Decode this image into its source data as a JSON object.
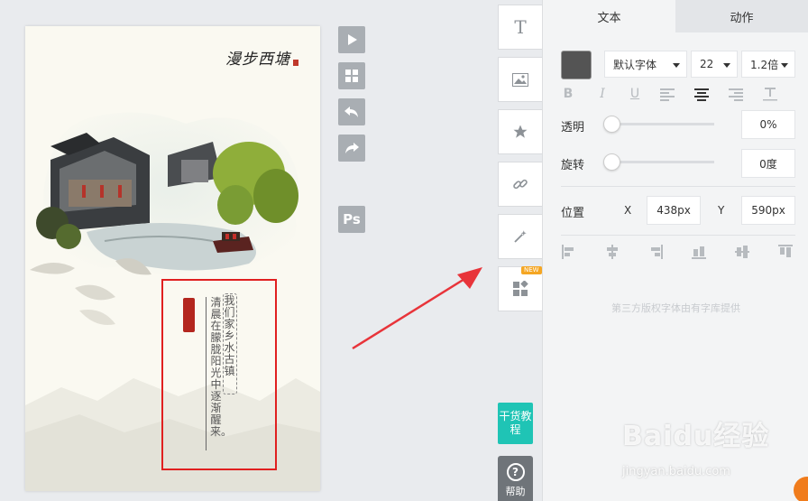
{
  "poster": {
    "title": "漫步西塘",
    "vertical_main": "清晨在朦胧阳光中逐渐醒来。",
    "vertical_sub": "我们家乡水古镇"
  },
  "canvas_tools": {
    "preview": "play-icon",
    "grid": "grid-icon",
    "undo": "undo-icon",
    "redo": "redo-icon",
    "ps_label": "Ps"
  },
  "widgets": {
    "text_label": "T",
    "new_badge": "NEW",
    "goods_label": "干货教程",
    "help_label": "帮助",
    "help_icon_glyph": "?"
  },
  "panel": {
    "tabs": [
      "文本",
      "动作"
    ],
    "font_color": "#545454",
    "font_family": "默认字体",
    "font_size": "22",
    "line_height": "1.2倍",
    "format_bold": "B",
    "format_italic": "I",
    "format_underline": "U",
    "opacity_label": "透明",
    "opacity_value": "0%",
    "opacity_level": 0,
    "rotation_label": "旋转",
    "rotation_value": "0度",
    "rotation_level": 0,
    "position_label": "位置",
    "x_label": "X",
    "x_value": "438px",
    "y_label": "Y",
    "y_value": "590px",
    "footnote": "第三方版权字体由有字库提供"
  },
  "watermark": {
    "brand": "Baidu经验",
    "url": "jingyan.baidu.com"
  },
  "colors": {
    "accent_teal": "#1fc4b5",
    "highlight_red": "#e02020",
    "arrow_red": "#e8343a"
  }
}
